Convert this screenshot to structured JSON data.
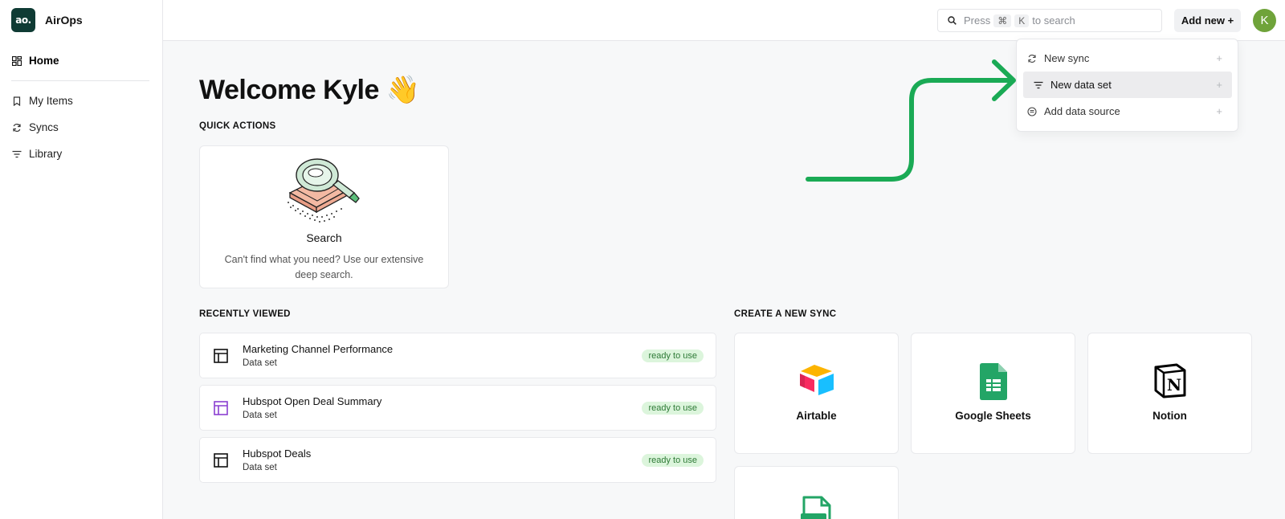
{
  "app": {
    "logo_text": "ao.",
    "name": "AirOps"
  },
  "sidebar": {
    "items": [
      {
        "label": "Home",
        "icon": "grid-icon"
      },
      {
        "label": "My Items",
        "icon": "bookmark-icon"
      },
      {
        "label": "Syncs",
        "icon": "sync-icon"
      },
      {
        "label": "Library",
        "icon": "filter-lines-icon"
      }
    ]
  },
  "topbar": {
    "search_pre": "Press",
    "search_key1": "⌘",
    "search_key2": "K",
    "search_post": "to search",
    "add_new_label": "Add new +",
    "avatar_initial": "K"
  },
  "dropdown": {
    "items": [
      {
        "label": "New sync",
        "icon": "sync-icon"
      },
      {
        "label": "New data set",
        "icon": "filter-lines-icon"
      },
      {
        "label": "Add data source",
        "icon": "database-icon"
      }
    ]
  },
  "main": {
    "welcome": "Welcome Kyle 👋",
    "quick_actions_label": "QUICK ACTIONS",
    "quick_action": {
      "title": "Search",
      "description": "Can't find what you need? Use our extensive deep search."
    },
    "recently_viewed_label": "RECENTLY VIEWED",
    "recent": [
      {
        "title": "Marketing Channel Performance",
        "sub": "Data set",
        "status": "ready to use"
      },
      {
        "title": "Hubspot Open Deal Summary",
        "sub": "Data set",
        "status": "ready to use"
      },
      {
        "title": "Hubspot Deals",
        "sub": "Data set",
        "status": "ready to use"
      }
    ],
    "create_sync_label": "CREATE A NEW SYNC",
    "sources": [
      {
        "label": "Airtable",
        "icon": "airtable-icon"
      },
      {
        "label": "Google Sheets",
        "icon": "google-sheets-icon"
      },
      {
        "label": "Notion",
        "icon": "notion-icon"
      },
      {
        "label": "",
        "icon": "csv-icon"
      }
    ]
  },
  "colors": {
    "brand": "#0f3b34",
    "accent_arrow": "#1aaa55",
    "badge_bg": "#dcf5dc",
    "badge_text": "#2e7a36",
    "avatar": "#6fa33a"
  }
}
